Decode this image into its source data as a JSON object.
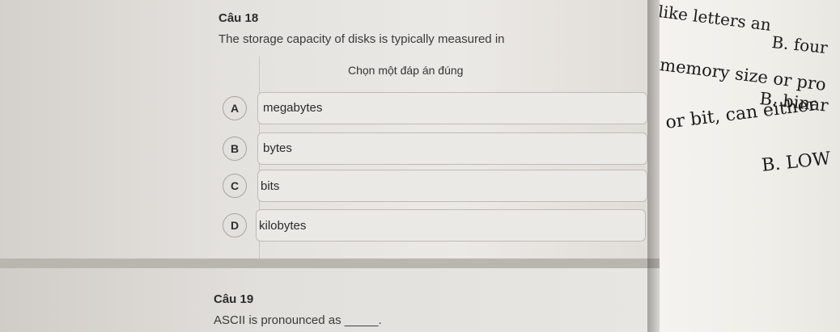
{
  "question18": {
    "label": "Câu 18",
    "text": "The storage capacity of disks is typically measured in",
    "instruction": "Chọn một đáp án đúng",
    "options": [
      {
        "letter": "A",
        "text": "megabytes"
      },
      {
        "letter": "B",
        "text": "bytes"
      },
      {
        "letter": "C",
        "text": "bits"
      },
      {
        "letter": "D",
        "text": "kilobytes"
      }
    ]
  },
  "question19": {
    "label": "Câu 19",
    "text": "ASCII is pronounced as _____."
  },
  "book": {
    "line1": "like letters an",
    "line2": "B. four",
    "line3": "memory size or pro",
    "line4": "B. binar",
    "line5": "or bit, can either",
    "line6": "B. LOW"
  }
}
